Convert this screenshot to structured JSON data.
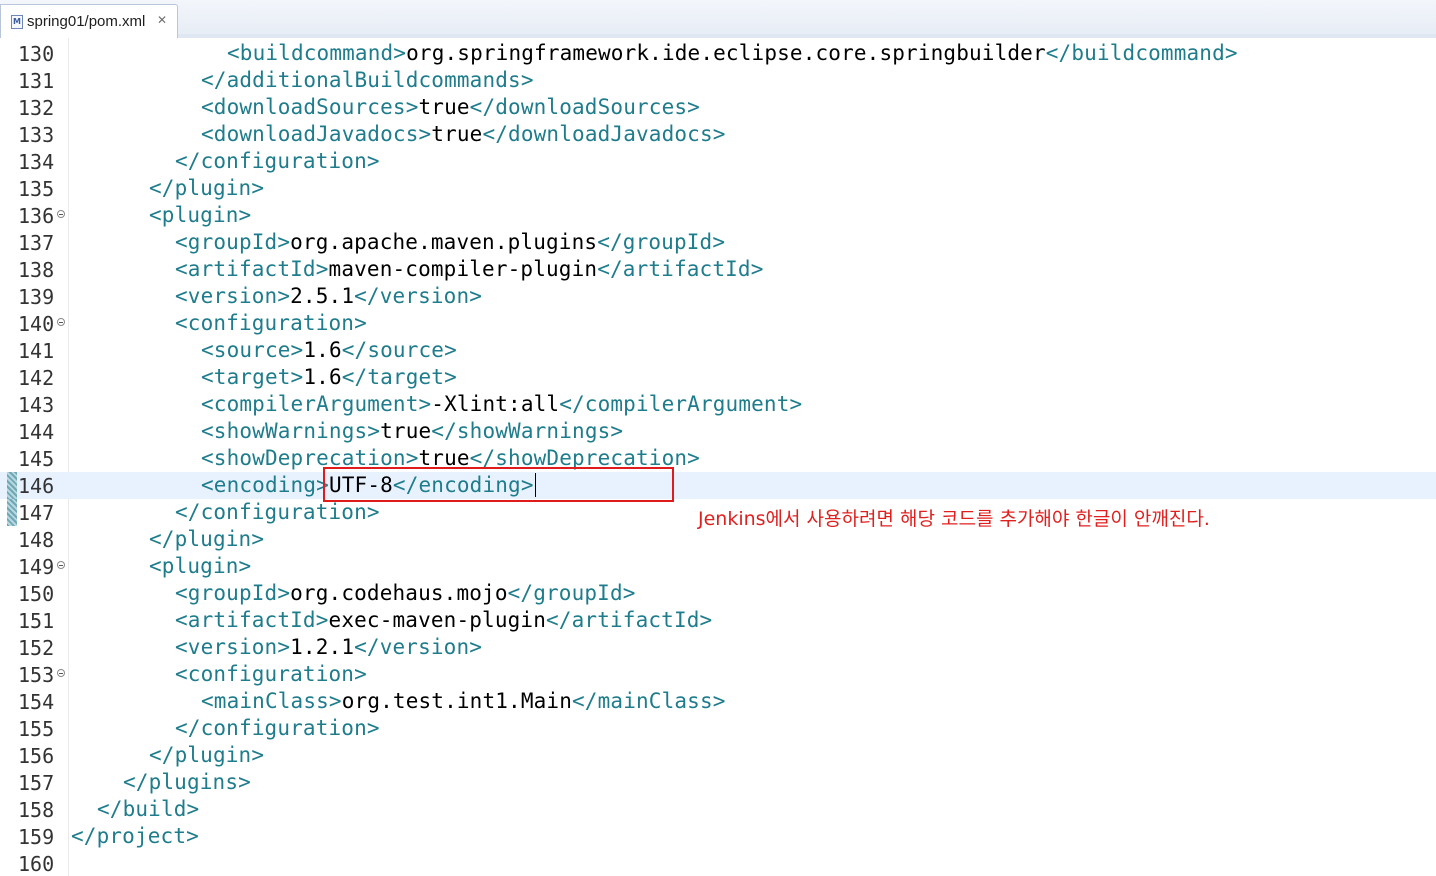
{
  "tab": {
    "label": "spring01/pom.xml",
    "icon": "maven-file-icon",
    "close_glyph": "✕"
  },
  "colors": {
    "tag": "#1e7c8c",
    "text": "#000000",
    "annotation": "#e0201f",
    "current_line": "#e8f2fe"
  },
  "lines": [
    {
      "num": "130",
      "indent": 12,
      "parts": [
        [
          "t",
          "<buildcommand>"
        ],
        [
          "v",
          "org.springframework.ide.eclipse.core.springbuilder"
        ],
        [
          "t",
          "</buildcommand>"
        ]
      ]
    },
    {
      "num": "131",
      "indent": 10,
      "parts": [
        [
          "t",
          "</additionalBuildcommands>"
        ]
      ]
    },
    {
      "num": "132",
      "indent": 10,
      "parts": [
        [
          "t",
          "<downloadSources>"
        ],
        [
          "v",
          "true"
        ],
        [
          "t",
          "</downloadSources>"
        ]
      ]
    },
    {
      "num": "133",
      "indent": 10,
      "parts": [
        [
          "t",
          "<downloadJavadocs>"
        ],
        [
          "v",
          "true"
        ],
        [
          "t",
          "</downloadJavadocs>"
        ]
      ]
    },
    {
      "num": "134",
      "indent": 8,
      "parts": [
        [
          "t",
          "</configuration>"
        ]
      ]
    },
    {
      "num": "135",
      "indent": 6,
      "parts": [
        [
          "t",
          "</plugin>"
        ]
      ]
    },
    {
      "num": "136",
      "indent": 6,
      "fold": true,
      "parts": [
        [
          "t",
          "<plugin>"
        ]
      ]
    },
    {
      "num": "137",
      "indent": 8,
      "parts": [
        [
          "t",
          "<groupId>"
        ],
        [
          "v",
          "org.apache.maven.plugins"
        ],
        [
          "t",
          "</groupId>"
        ]
      ]
    },
    {
      "num": "138",
      "indent": 8,
      "parts": [
        [
          "t",
          "<artifactId>"
        ],
        [
          "v",
          "maven-compiler-plugin"
        ],
        [
          "t",
          "</artifactId>"
        ]
      ]
    },
    {
      "num": "139",
      "indent": 8,
      "parts": [
        [
          "t",
          "<version>"
        ],
        [
          "v",
          "2.5.1"
        ],
        [
          "t",
          "</version>"
        ]
      ]
    },
    {
      "num": "140",
      "indent": 8,
      "fold": true,
      "parts": [
        [
          "t",
          "<configuration>"
        ]
      ]
    },
    {
      "num": "141",
      "indent": 10,
      "parts": [
        [
          "t",
          "<source>"
        ],
        [
          "v",
          "1.6"
        ],
        [
          "t",
          "</source>"
        ]
      ]
    },
    {
      "num": "142",
      "indent": 10,
      "parts": [
        [
          "t",
          "<target>"
        ],
        [
          "v",
          "1.6"
        ],
        [
          "t",
          "</target>"
        ]
      ]
    },
    {
      "num": "143",
      "indent": 10,
      "parts": [
        [
          "t",
          "<compilerArgument>"
        ],
        [
          "v",
          "-Xlint:all"
        ],
        [
          "t",
          "</compilerArgument>"
        ]
      ]
    },
    {
      "num": "144",
      "indent": 10,
      "parts": [
        [
          "t",
          "<showWarnings>"
        ],
        [
          "v",
          "true"
        ],
        [
          "t",
          "</showWarnings>"
        ]
      ]
    },
    {
      "num": "145",
      "indent": 10,
      "parts": [
        [
          "t",
          "<showDeprecation>"
        ],
        [
          "v",
          "true"
        ],
        [
          "t",
          "</showDeprecation>"
        ]
      ]
    },
    {
      "num": "146",
      "indent": 10,
      "current": true,
      "changed": true,
      "parts": [
        [
          "t",
          "<encoding>"
        ],
        [
          "v",
          "UTF-8"
        ],
        [
          "t",
          "</encoding>"
        ]
      ]
    },
    {
      "num": "147",
      "indent": 8,
      "changed": true,
      "parts": [
        [
          "t",
          "</configuration>"
        ]
      ]
    },
    {
      "num": "148",
      "indent": 6,
      "parts": [
        [
          "t",
          "</plugin>"
        ]
      ]
    },
    {
      "num": "149",
      "indent": 6,
      "fold": true,
      "parts": [
        [
          "t",
          "<plugin>"
        ]
      ]
    },
    {
      "num": "150",
      "indent": 8,
      "parts": [
        [
          "t",
          "<groupId>"
        ],
        [
          "v",
          "org.codehaus.mojo"
        ],
        [
          "t",
          "</groupId>"
        ]
      ]
    },
    {
      "num": "151",
      "indent": 8,
      "parts": [
        [
          "t",
          "<artifactId>"
        ],
        [
          "v",
          "exec-maven-plugin"
        ],
        [
          "t",
          "</artifactId>"
        ]
      ]
    },
    {
      "num": "152",
      "indent": 8,
      "parts": [
        [
          "t",
          "<version>"
        ],
        [
          "v",
          "1.2.1"
        ],
        [
          "t",
          "</version>"
        ]
      ]
    },
    {
      "num": "153",
      "indent": 8,
      "fold": true,
      "parts": [
        [
          "t",
          "<configuration>"
        ]
      ]
    },
    {
      "num": "154",
      "indent": 10,
      "parts": [
        [
          "t",
          "<mainClass>"
        ],
        [
          "v",
          "org.test.int1.Main"
        ],
        [
          "t",
          "</mainClass>"
        ]
      ]
    },
    {
      "num": "155",
      "indent": 8,
      "parts": [
        [
          "t",
          "</configuration>"
        ]
      ]
    },
    {
      "num": "156",
      "indent": 6,
      "parts": [
        [
          "t",
          "</plugin>"
        ]
      ]
    },
    {
      "num": "157",
      "indent": 4,
      "parts": [
        [
          "t",
          "</plugins>"
        ]
      ]
    },
    {
      "num": "158",
      "indent": 2,
      "parts": [
        [
          "t",
          "</build>"
        ]
      ]
    },
    {
      "num": "159",
      "indent": 0,
      "parts": [
        [
          "t",
          "</project>"
        ]
      ]
    },
    {
      "num": "160",
      "indent": 0,
      "parts": []
    }
  ],
  "annotation": {
    "text": "Jenkins에서 사용하려면 해당 코드를 추가해야 한글이 안깨진다."
  }
}
